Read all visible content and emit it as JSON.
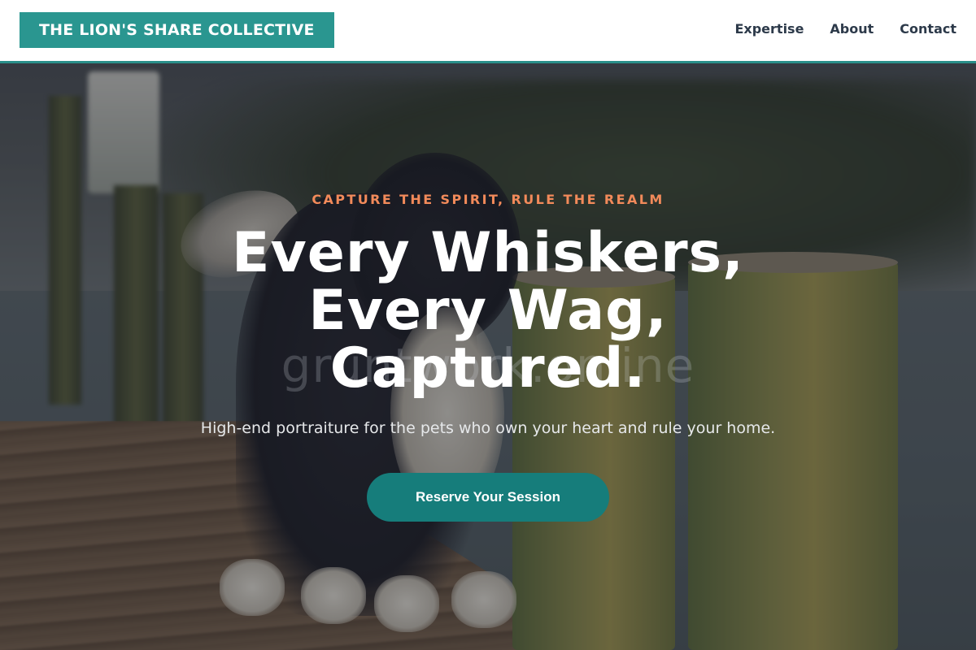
{
  "header": {
    "brand": "THE LION'S SHARE COLLECTIVE",
    "nav": [
      {
        "label": "Expertise"
      },
      {
        "label": "About"
      },
      {
        "label": "Contact"
      }
    ]
  },
  "hero": {
    "eyebrow": "CAPTURE THE SPIRIT, RULE THE REALM",
    "headline_lines": [
      "Every Whiskers,",
      "Every Wag,",
      "Captured."
    ],
    "subhead": "High-end portraiture for the pets who own your heart and rule your home.",
    "cta_label": "Reserve Your Session",
    "watermark": "gruntwork.online",
    "background_image": "dog-on-dock-photo"
  },
  "colors": {
    "brand_teal": "#2a9690",
    "cta_teal": "#167d7b",
    "eyebrow_orange": "#f28a5a",
    "nav_text": "#2d3a4a"
  }
}
